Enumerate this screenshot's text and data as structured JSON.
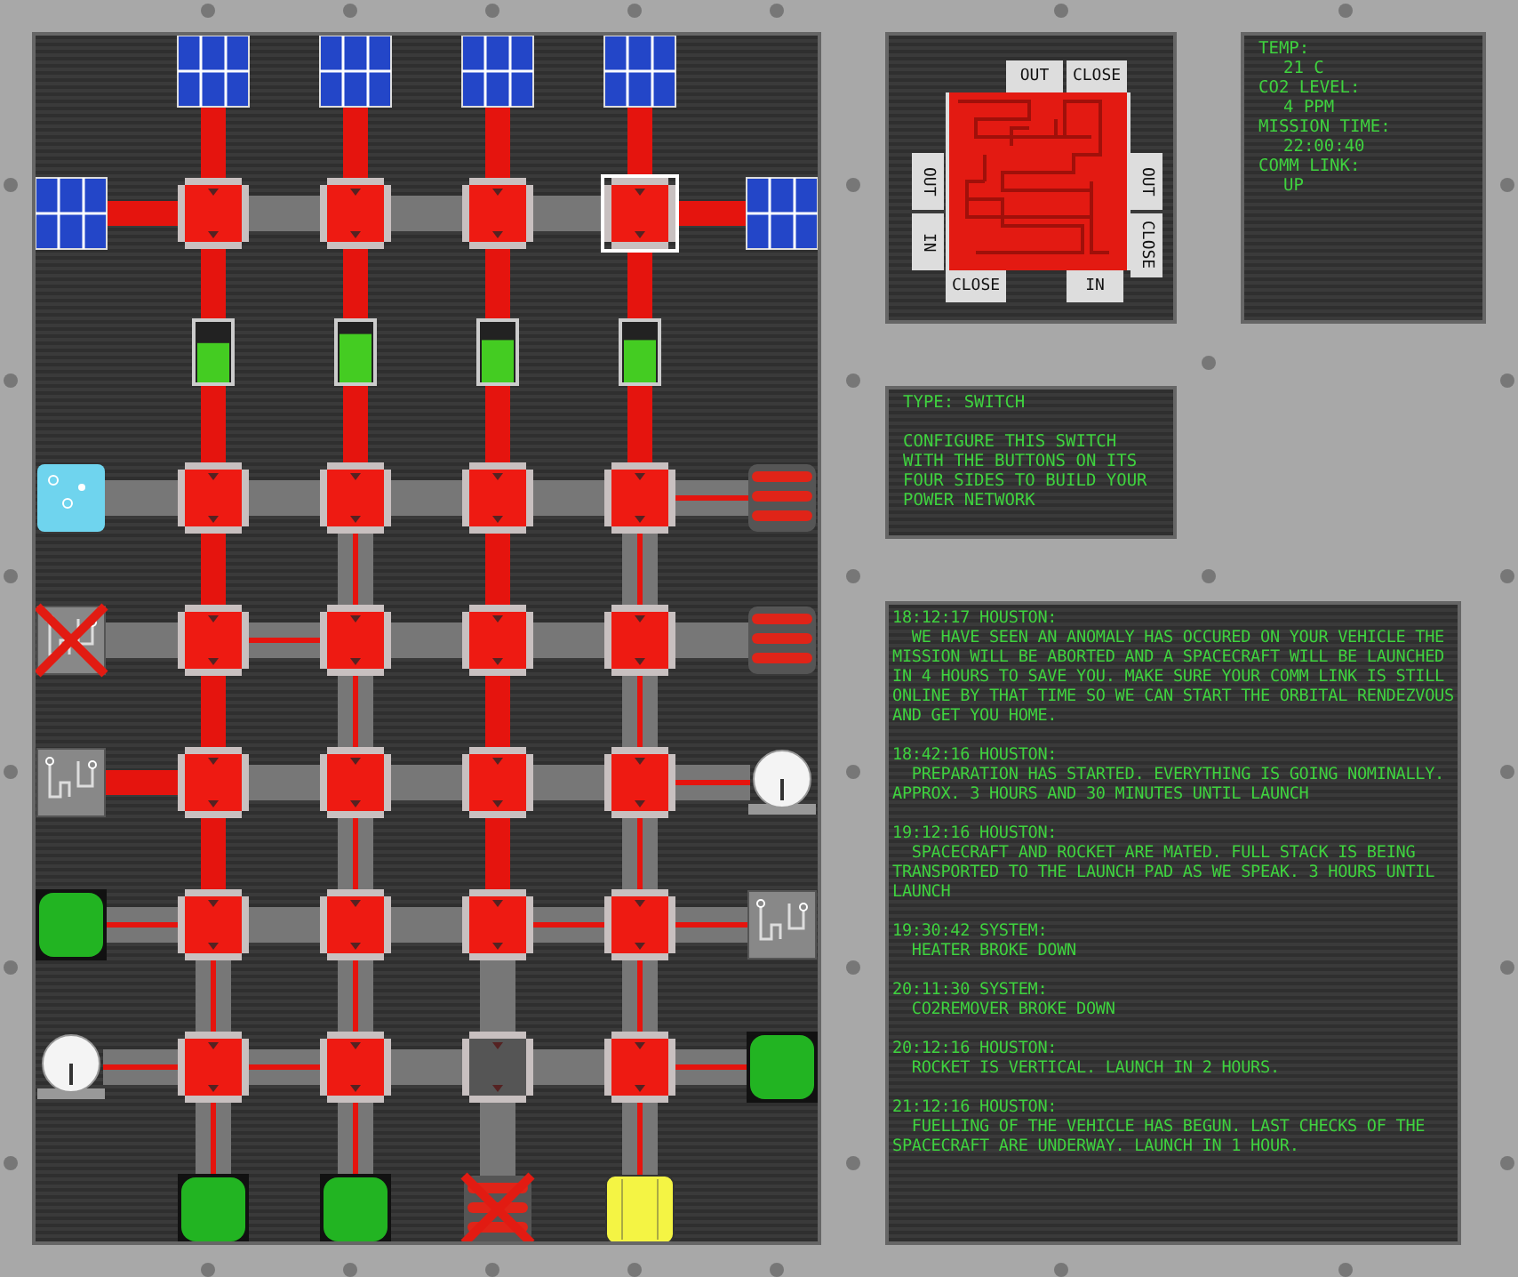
{
  "board": {
    "rows": [
      {
        "left": {
          "kind": "solar",
          "broken": false
        },
        "right": {
          "kind": "solar",
          "broken": false
        },
        "switches": [
          {
            "powered": true,
            "selected": false
          },
          {
            "powered": true,
            "selected": false
          },
          {
            "powered": true,
            "selected": false
          },
          {
            "powered": true,
            "selected": true
          }
        ],
        "links": [
          {
            "kind": "wire",
            "powered": true
          },
          {
            "kind": "conduit",
            "powered": false
          },
          {
            "kind": "conduit",
            "powered": false
          },
          {
            "kind": "conduit",
            "powered": false
          },
          {
            "kind": "wire",
            "powered": true
          }
        ]
      },
      {
        "left": {
          "kind": "water",
          "broken": false
        },
        "right": {
          "kind": "heater",
          "broken": false
        },
        "switches": [
          {
            "powered": true,
            "selected": false
          },
          {
            "powered": true,
            "selected": false
          },
          {
            "powered": true,
            "selected": false
          },
          {
            "powered": true,
            "selected": false
          }
        ],
        "links": [
          {
            "kind": "conduit",
            "powered": false
          },
          {
            "kind": "conduit",
            "powered": false
          },
          {
            "kind": "conduit",
            "powered": false
          },
          {
            "kind": "conduit",
            "powered": false
          },
          {
            "kind": "conduit",
            "powered": true
          }
        ]
      },
      {
        "left": {
          "kind": "circuit",
          "broken": true
        },
        "right": {
          "kind": "heater",
          "broken": false
        },
        "switches": [
          {
            "powered": true,
            "selected": false
          },
          {
            "powered": true,
            "selected": false
          },
          {
            "powered": true,
            "selected": false
          },
          {
            "powered": true,
            "selected": false
          }
        ],
        "links": [
          {
            "kind": "conduit",
            "powered": false
          },
          {
            "kind": "conduit",
            "powered": true
          },
          {
            "kind": "conduit",
            "powered": false
          },
          {
            "kind": "conduit",
            "powered": false
          },
          {
            "kind": "conduit",
            "powered": false
          }
        ]
      },
      {
        "left": {
          "kind": "circuit",
          "broken": false
        },
        "right": {
          "kind": "dish",
          "broken": false
        },
        "switches": [
          {
            "powered": true,
            "selected": false
          },
          {
            "powered": true,
            "selected": false
          },
          {
            "powered": true,
            "selected": false
          },
          {
            "powered": true,
            "selected": false
          }
        ],
        "links": [
          {
            "kind": "wire",
            "powered": true
          },
          {
            "kind": "conduit",
            "powered": false
          },
          {
            "kind": "conduit",
            "powered": false
          },
          {
            "kind": "conduit",
            "powered": false
          },
          {
            "kind": "conduit",
            "powered": true
          }
        ]
      },
      {
        "left": {
          "kind": "pad",
          "broken": false
        },
        "right": {
          "kind": "circuit",
          "broken": false
        },
        "switches": [
          {
            "powered": true,
            "selected": false
          },
          {
            "powered": true,
            "selected": false
          },
          {
            "powered": true,
            "selected": false
          },
          {
            "powered": true,
            "selected": false
          }
        ],
        "links": [
          {
            "kind": "conduit",
            "powered": true
          },
          {
            "kind": "conduit",
            "powered": false
          },
          {
            "kind": "conduit",
            "powered": false
          },
          {
            "kind": "conduit",
            "powered": true
          },
          {
            "kind": "conduit",
            "powered": true
          }
        ]
      },
      {
        "left": {
          "kind": "dish",
          "broken": false
        },
        "right": {
          "kind": "pad",
          "broken": false
        },
        "switches": [
          {
            "powered": true,
            "selected": false
          },
          {
            "powered": true,
            "selected": false
          },
          {
            "powered": false,
            "selected": false
          },
          {
            "powered": true,
            "selected": false
          }
        ],
        "links": [
          {
            "kind": "conduit",
            "powered": true
          },
          {
            "kind": "conduit",
            "powered": true
          },
          {
            "kind": "conduit",
            "powered": false
          },
          {
            "kind": "conduit",
            "powered": false
          },
          {
            "kind": "conduit",
            "powered": true
          }
        ]
      }
    ],
    "columns": [
      {
        "top": {
          "kind": "solar",
          "broken": false
        },
        "battery": {
          "level": 0.65
        },
        "bottom": {
          "kind": "pad",
          "broken": false
        },
        "links": [
          {
            "kind": "wire",
            "powered": true
          },
          {
            "kind": "wire",
            "powered": true
          },
          {
            "kind": "wire",
            "powered": true
          },
          {
            "kind": "wire",
            "powered": true
          },
          {
            "kind": "wire",
            "powered": true
          },
          {
            "kind": "wire",
            "powered": true
          },
          {
            "kind": "conduit",
            "powered": true
          },
          {
            "kind": "conduit",
            "powered": true
          }
        ]
      },
      {
        "top": {
          "kind": "solar",
          "broken": false
        },
        "battery": {
          "level": 0.8
        },
        "bottom": {
          "kind": "pad",
          "broken": false
        },
        "links": [
          {
            "kind": "wire",
            "powered": true
          },
          {
            "kind": "wire",
            "powered": true
          },
          {
            "kind": "wire",
            "powered": true
          },
          {
            "kind": "conduit",
            "powered": true
          },
          {
            "kind": "conduit",
            "powered": true
          },
          {
            "kind": "conduit",
            "powered": true
          },
          {
            "kind": "conduit",
            "powered": true
          },
          {
            "kind": "conduit",
            "powered": true
          }
        ]
      },
      {
        "top": {
          "kind": "solar",
          "broken": false
        },
        "battery": {
          "level": 0.7
        },
        "bottom": {
          "kind": "heater",
          "broken": true
        },
        "links": [
          {
            "kind": "wire",
            "powered": true
          },
          {
            "kind": "wire",
            "powered": true
          },
          {
            "kind": "wire",
            "powered": true
          },
          {
            "kind": "wire",
            "powered": true
          },
          {
            "kind": "wire",
            "powered": true
          },
          {
            "kind": "wire",
            "powered": true
          },
          {
            "kind": "conduit",
            "powered": false
          },
          {
            "kind": "conduit",
            "powered": false
          }
        ]
      },
      {
        "top": {
          "kind": "solar",
          "broken": false
        },
        "battery": {
          "level": 0.7
        },
        "bottom": {
          "kind": "block",
          "broken": false
        },
        "links": [
          {
            "kind": "wire",
            "powered": true
          },
          {
            "kind": "wire",
            "powered": true
          },
          {
            "kind": "wire",
            "powered": true
          },
          {
            "kind": "conduit",
            "powered": true
          },
          {
            "kind": "conduit",
            "powered": true
          },
          {
            "kind": "conduit",
            "powered": true
          },
          {
            "kind": "conduit",
            "powered": true
          },
          {
            "kind": "conduit",
            "powered": true
          }
        ]
      }
    ]
  },
  "switch_config": {
    "top": [
      "OUT",
      "CLOSE"
    ],
    "left": [
      "OUT",
      "IN"
    ],
    "right": [
      "OUT",
      "CLOSE"
    ],
    "bottom": [
      "CLOSE",
      "IN"
    ]
  },
  "status": [
    {
      "label": "TEMP:",
      "value": "21 C"
    },
    {
      "label": "CO2 LEVEL:",
      "value": "4 PPM"
    },
    {
      "label": "MISSION TIME:",
      "value": "22:00:40"
    },
    {
      "label": "COMM LINK:",
      "value": "UP"
    }
  ],
  "info": {
    "type": "TYPE: SWITCH",
    "description": "CONFIGURE THIS SWITCH WITH THE BUTTONS ON ITS FOUR SIDES TO BUILD YOUR POWER NETWORK"
  },
  "log": [
    {
      "header": "18:12:17 HOUSTON:",
      "message": "  WE HAVE SEEN AN ANOMALY HAS OCCURED ON YOUR VEHICLE THE MISSION WILL BE ABORTED AND A SPACECRAFT WILL BE LAUNCHED IN 4 HOURS TO SAVE YOU. MAKE SURE YOUR COMM LINK IS STILL ONLINE BY THAT TIME SO WE CAN START THE ORBITAL RENDEZVOUS AND GET YOU HOME."
    },
    {
      "header": "18:42:16 HOUSTON:",
      "message": "  PREPARATION HAS STARTED. EVERYTHING IS GOING NOMINALLY. APPROX. 3 HOURS AND 30 MINUTES UNTIL LAUNCH"
    },
    {
      "header": "19:12:16 HOUSTON:",
      "message": "  SPACECRAFT AND ROCKET ARE MATED. FULL STACK IS BEING TRANSPORTED TO THE LAUNCH PAD AS WE SPEAK. 3 HOURS UNTIL LAUNCH"
    },
    {
      "header": "19:30:42 SYSTEM:",
      "message": "  HEATER BROKE DOWN"
    },
    {
      "header": "20:11:30 SYSTEM:",
      "message": "  CO2REMOVER BROKE DOWN"
    },
    {
      "header": "20:12:16 HOUSTON:",
      "message": "  ROCKET IS VERTICAL. LAUNCH IN 2 HOURS."
    },
    {
      "header": "21:12:16 HOUSTON:",
      "message": "  FUELLING OF THE VEHICLE HAS BEGUN. LAST CHECKS OF THE SPACECRAFT ARE UNDERWAY. LAUNCH IN 1 HOUR."
    }
  ]
}
